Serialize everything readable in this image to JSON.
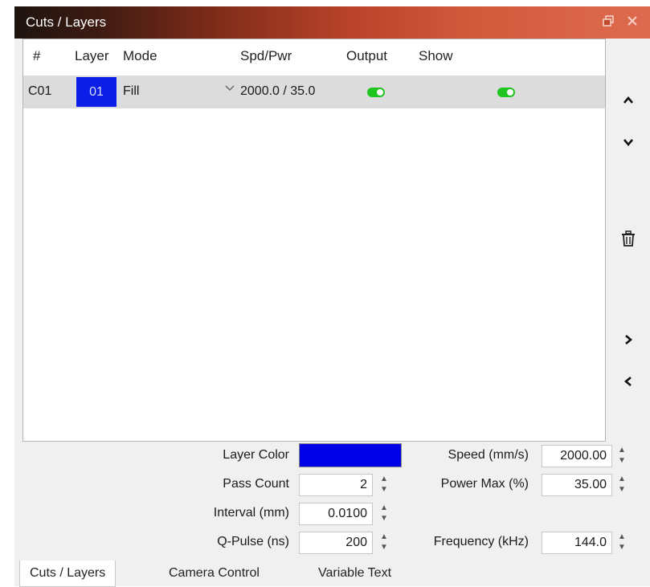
{
  "window": {
    "title": "Cuts / Layers",
    "float_icon": "restore-float-icon",
    "close_icon": "close-icon"
  },
  "table": {
    "headers": [
      "#",
      "Layer",
      "Mode",
      "Spd/Pwr",
      "Output",
      "Show"
    ],
    "rows": [
      {
        "num": "C01",
        "layer": "01",
        "layer_color": "#0a1ee8",
        "mode": "Fill",
        "spdpwr": "2000.0 / 35.0",
        "output": true,
        "show": true
      }
    ]
  },
  "side_buttons": [
    "move-up-icon",
    "move-down-icon",
    "delete-trash-icon",
    "expand-right-icon",
    "collapse-left-icon"
  ],
  "properties": {
    "layer_color_label": "Layer Color",
    "layer_color": "#0000e6",
    "speed_label": "Speed (mm/s)",
    "speed_value": "2000.00",
    "pass_count_label": "Pass Count",
    "pass_count_value": "2",
    "power_max_label": "Power Max (%)",
    "power_max_value": "35.00",
    "interval_label": "Interval (mm)",
    "interval_value": "0.0100",
    "qpulse_label": "Q-Pulse (ns)",
    "qpulse_value": "200",
    "frequency_label": "Frequency (kHz)",
    "frequency_value": "144.0"
  },
  "tabs": [
    "Cuts / Layers",
    "Camera Control",
    "Variable Text"
  ],
  "active_tab": 0
}
